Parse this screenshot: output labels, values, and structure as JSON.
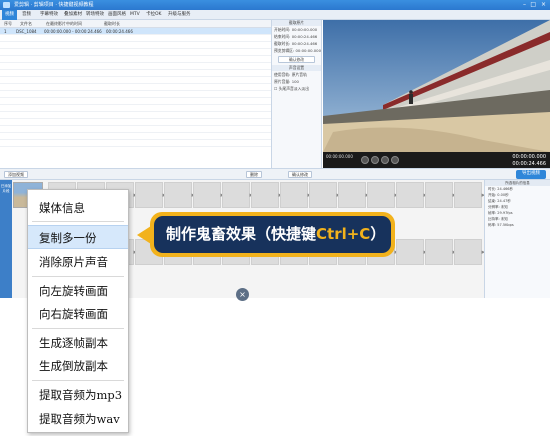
{
  "window": {
    "title": "爱剪辑 · 剪辑项目 · 快捷键视频教程",
    "controls": [
      "–",
      "□",
      "×"
    ]
  },
  "menu": {
    "items": [
      "视频",
      "音频",
      "字幕特效",
      "叠加素材",
      "转场特效",
      "画面风格",
      "MTV",
      "卡拉OK",
      "升级与服务"
    ]
  },
  "file_list": {
    "headers": [
      "序号",
      "文件名",
      "在最终影片中的时间",
      "截取时长"
    ],
    "rows": [
      {
        "no": "1",
        "name": "DSC_1084",
        "range": "00:00:00.000 - 00:00:24.466",
        "duration": "00:00:24.466"
      }
    ]
  },
  "clip_panel": {
    "section1": "截取原片",
    "labels": [
      "开始时间:",
      "结束时间:",
      "截取时长:",
      "预览剪辑区:"
    ],
    "values": [
      "00:00:00.000",
      "00:00:24.466",
      "00:00:24.466",
      "00:00:00.000"
    ],
    "confirm": "确认修改",
    "section2": "声音设置",
    "audio_label": "使用音轨:",
    "audio_value": "原片音轨",
    "volume_label": "原片音量:",
    "volume_value": "100",
    "mute_label": "头尾声音淡入淡出"
  },
  "player": {
    "left_time": "00:00:00.000",
    "right_time1": "00:00:00.000",
    "right_time2": "00:00:24.466"
  },
  "toolstrip": {
    "add_label": "添加视频",
    "delete_label": "删除",
    "confirm_label": "确认修改",
    "export_label": "导出视频"
  },
  "timeline": {
    "track_label": "已添加片段",
    "cells": 15
  },
  "props_panel": {
    "header": "所选相片的信息",
    "rows": [
      "时长:   24.466秒",
      "开始:   0.00秒",
      "结束:   24.47秒",
      "分辨率: 未知",
      "帧率:   29.97fps",
      "比特率: 未知",
      "码率:   57.5Kbps"
    ]
  },
  "context_menu": {
    "items": [
      "媒体信息",
      "复制多一份",
      "消除原片声音",
      "向左旋转画面",
      "向右旋转画面",
      "生成逐帧副本",
      "生成倒放副本",
      "提取音频为mp3",
      "提取音频为wav"
    ],
    "highlighted_index": 1
  },
  "callout": {
    "text": "制作鬼畜效果（快捷键",
    "shortcut": "Ctrl+C",
    "close": "）"
  },
  "colors": {
    "accent": "#2f86d9",
    "callout_bg": "#17325c",
    "callout_border": "#f2b21c"
  }
}
